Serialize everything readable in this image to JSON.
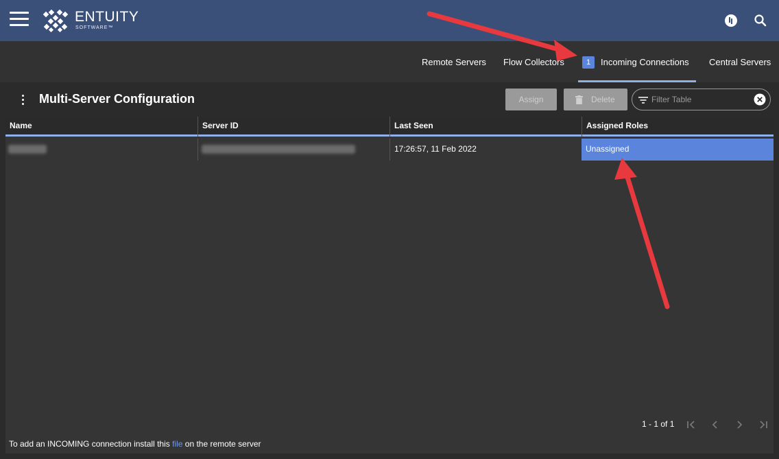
{
  "brand": {
    "name": "ENTUITY",
    "sub": "SOFTWARE™"
  },
  "header_icons": [
    "user-icon",
    "search-icon"
  ],
  "tabs": [
    {
      "label": "Remote Servers",
      "badge": "",
      "active": false
    },
    {
      "label": "Flow Collectors",
      "badge": "",
      "active": false
    },
    {
      "label": "Incoming Connections",
      "badge": "1",
      "active": true
    },
    {
      "label": "Central Servers",
      "badge": "",
      "active": false
    }
  ],
  "page": {
    "title": "Multi-Server Configuration"
  },
  "toolbar": {
    "assign_label": "Assign",
    "delete_label": "Delete",
    "filter_placeholder": "Filter Table",
    "filter_value": ""
  },
  "table": {
    "columns": [
      "Name",
      "Server ID",
      "Last Seen",
      "Assigned Roles"
    ],
    "rows": [
      {
        "name": "",
        "server_id": "",
        "last_seen": "17:26:57, 11 Feb 2022",
        "assigned_roles": "Unassigned"
      }
    ]
  },
  "pagination": {
    "label": "1 - 1 of 1"
  },
  "footer": {
    "before": "To add an INCOMING connection install this ",
    "link": "file",
    "after": " on the remote server"
  },
  "colors": {
    "header": "#3b5078",
    "accent": "#5b84dd",
    "tab_underline": "#8fb0e8",
    "annotation": "#e8393f"
  }
}
